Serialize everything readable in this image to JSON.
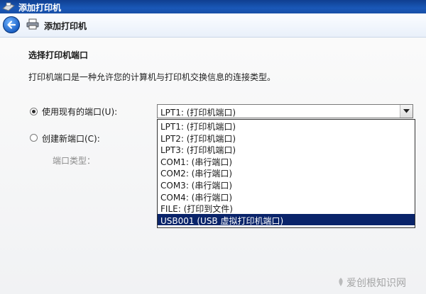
{
  "window": {
    "title": "添加打印机"
  },
  "nav": {
    "title": "添加打印机"
  },
  "page": {
    "heading": "选择打印机端口",
    "description": "打印机端口是一种允许您的计算机与打印机交换信息的连接类型。"
  },
  "options": {
    "existing_label": "使用现有的端口(U):",
    "existing_checked": true,
    "new_label": "创建新端口(C):",
    "new_checked": false,
    "port_type_label": "端口类型："
  },
  "port_select": {
    "value": "LPT1: (打印机端口)",
    "options": [
      "LPT1: (打印机端口)",
      "LPT2: (打印机端口)",
      "LPT3: (打印机端口)",
      "COM1: (串行端口)",
      "COM2: (串行端口)",
      "COM3: (串行端口)",
      "COM4: (串行端口)",
      "FILE: (打印到文件)",
      "USB001 (USB 虚拟打印机端口)"
    ],
    "highlighted_index": 8
  },
  "watermark": {
    "text": "爱创根知识网"
  },
  "colors": {
    "titlebar": "#1a58b8",
    "selection": "#0a246a",
    "content_bg": "#f4f5f7"
  }
}
